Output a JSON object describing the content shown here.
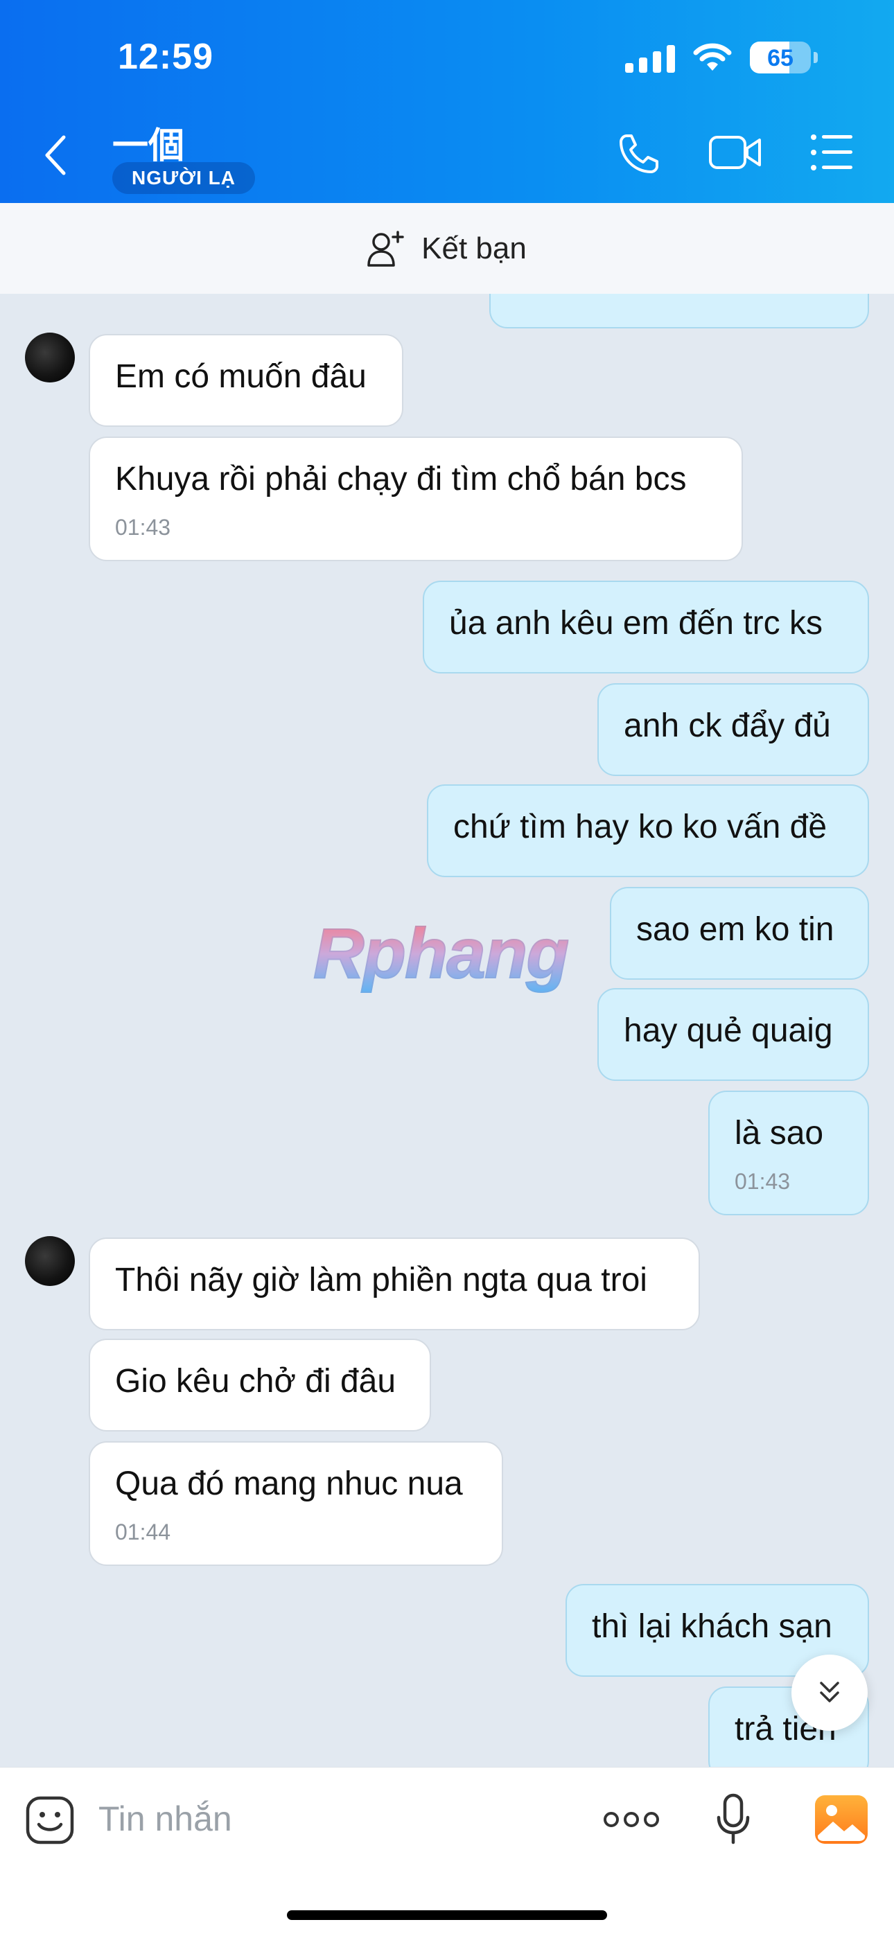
{
  "status_bar": {
    "time": "12:59",
    "battery": "65"
  },
  "header": {
    "contact_name": "一個",
    "badge": "NGƯỜI LẠ"
  },
  "add_friend": {
    "label": "Kết bạn"
  },
  "messages": [
    {
      "dir": "in",
      "text": "Em có muốn đâu",
      "time": null
    },
    {
      "dir": "in",
      "text": "Khuya rồi phải chạy đi tìm chổ bán bcs",
      "time": "01:43"
    },
    {
      "dir": "out",
      "text": "ủa anh kêu em đến trc ks",
      "time": null
    },
    {
      "dir": "out",
      "text": "anh ck đẩy đủ",
      "time": null
    },
    {
      "dir": "out",
      "text": "chứ tìm hay ko ko vấn đề",
      "time": null
    },
    {
      "dir": "out",
      "text": "sao em ko tin",
      "time": null
    },
    {
      "dir": "out",
      "text": "hay quẻ quaig",
      "time": null
    },
    {
      "dir": "out",
      "text": "là sao",
      "time": "01:43"
    },
    {
      "dir": "in",
      "text": "Thôi nãy giờ làm phiền ngta qua troi",
      "time": null
    },
    {
      "dir": "in",
      "text": "Gio kêu chở đi đâu",
      "time": null
    },
    {
      "dir": "in",
      "text": "Qua đó mang nhuc nua",
      "time": "01:44"
    },
    {
      "dir": "out",
      "text": "thì lại khách sạn",
      "time": null
    },
    {
      "dir": "out",
      "text": "trả tiền",
      "time": null
    }
  ],
  "watermark": "Rphang",
  "composer": {
    "placeholder": "Tin nhắn"
  },
  "colors": {
    "header_start": "#0a6ef0",
    "header_end": "#12a9f0",
    "outgoing_bubble": "#d4f1fd",
    "incoming_bubble": "#ffffff",
    "chat_bg": "#e2e9f1"
  }
}
